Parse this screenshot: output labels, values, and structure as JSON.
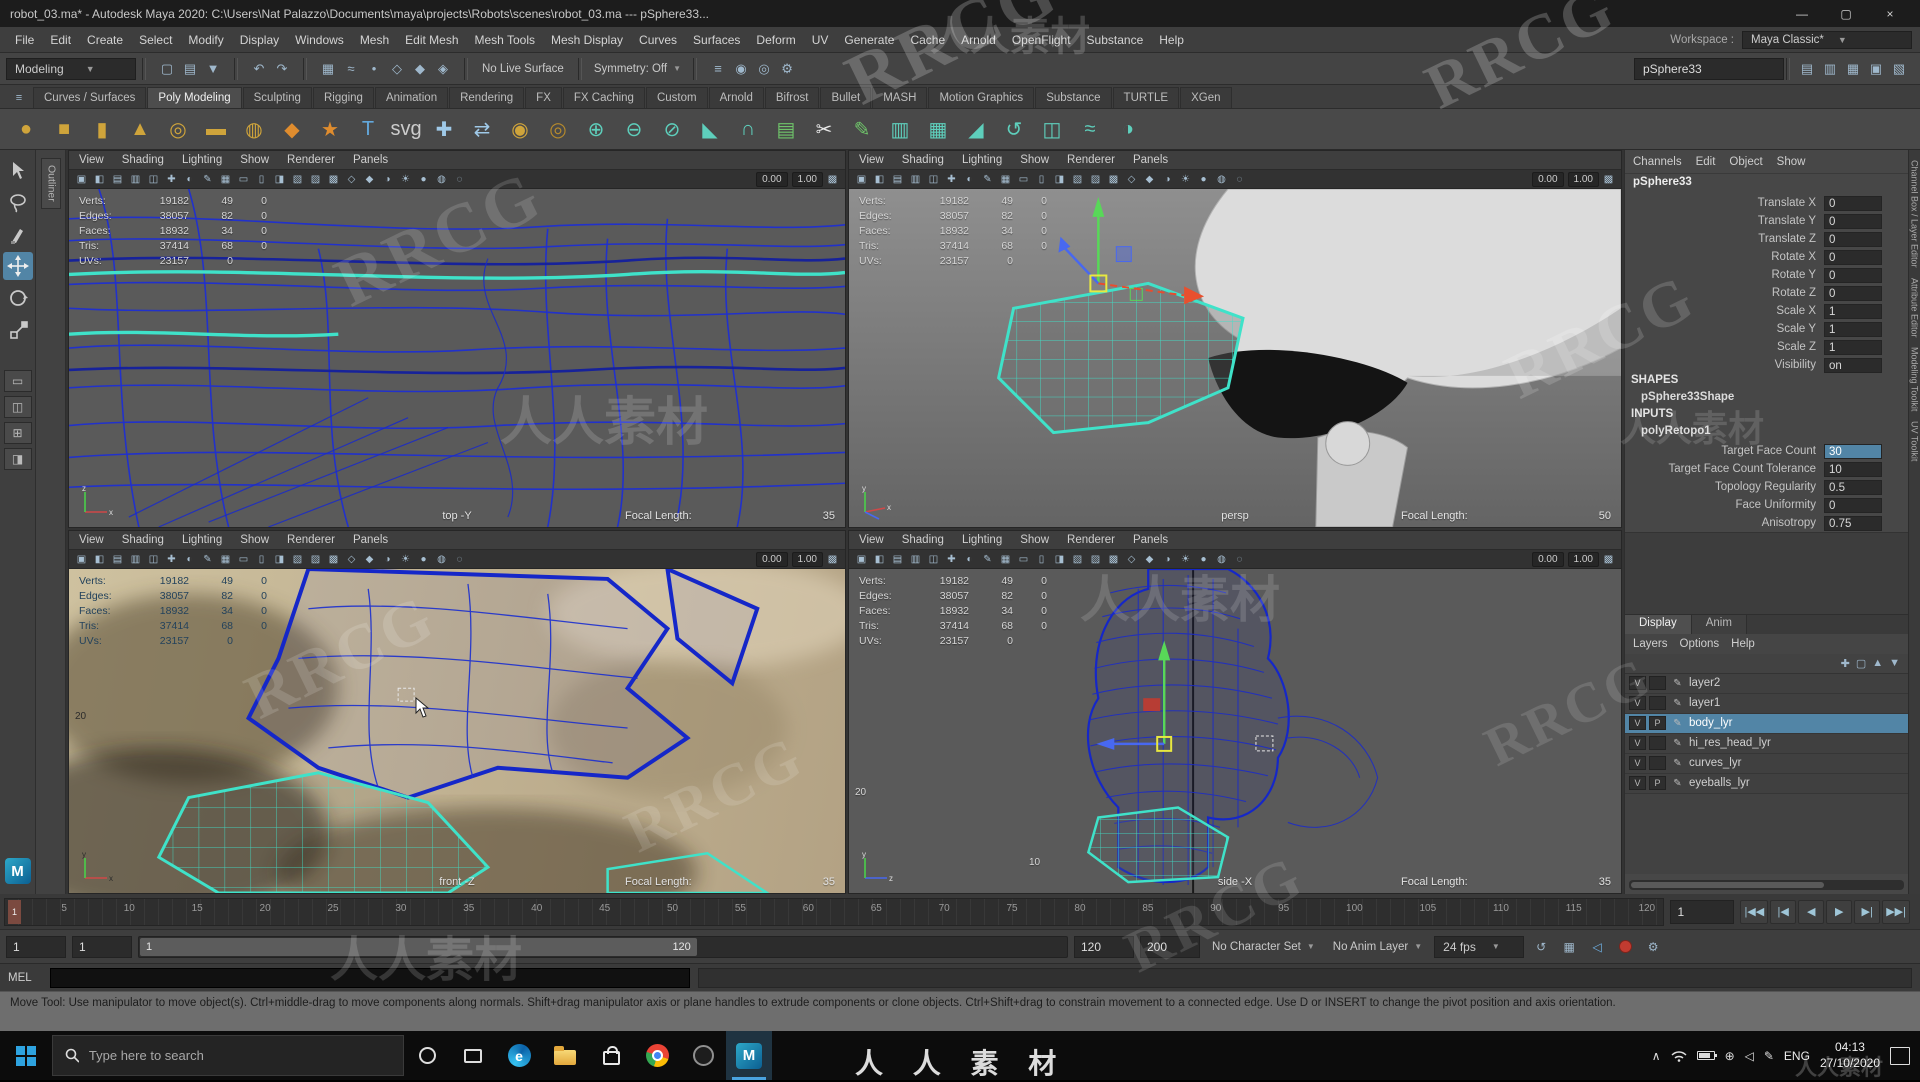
{
  "watermark": {
    "cn": "人人素材",
    "en": "RRCG",
    "taskbar_cn": "人 人 素 材"
  },
  "title_bar": {
    "title": "robot_03.ma* - Autodesk Maya 2020: C:\\Users\\Nat Palazzo\\Documents\\maya\\projects\\Robots\\scenes\\robot_03.ma  ---  pSphere33...",
    "minimize": "—",
    "maximize": "▢",
    "close": "×"
  },
  "menu_bar": {
    "items": [
      "File",
      "Edit",
      "Create",
      "Select",
      "Modify",
      "Display",
      "Windows",
      "Mesh",
      "Edit Mesh",
      "Mesh Tools",
      "Mesh Display",
      "Curves",
      "Surfaces",
      "Deform",
      "UV",
      "Generate",
      "Cache",
      "Arnold",
      "OpenFlight",
      "Substance",
      "Help"
    ],
    "workspace_label": "Workspace :",
    "workspace_value": "Maya Classic*",
    "workspace_caret": "▼"
  },
  "status_line": {
    "mode": "Modeling",
    "mode_caret": "▼",
    "file_icons": [
      {
        "name": "new-scene-icon",
        "glyph": "▢"
      },
      {
        "name": "open-scene-icon",
        "glyph": "▤"
      },
      {
        "name": "save-scene-icon",
        "glyph": "▼"
      }
    ],
    "undo_icons": [
      {
        "name": "undo-icon",
        "glyph": "↶"
      },
      {
        "name": "redo-icon",
        "glyph": "↷"
      }
    ],
    "snap_icons": [
      {
        "name": "snap-grid-icon",
        "glyph": "▦"
      },
      {
        "name": "snap-curve-icon",
        "glyph": "≈"
      },
      {
        "name": "snap-point-icon",
        "glyph": "•"
      },
      {
        "name": "snap-plane-icon",
        "glyph": "◇"
      },
      {
        "name": "snap-surface-icon",
        "glyph": "◆"
      },
      {
        "name": "make-live-icon",
        "glyph": "◈"
      }
    ],
    "history_icons": [
      {
        "name": "construction-history-icon",
        "glyph": "≡"
      },
      {
        "name": "render-icon",
        "glyph": "◉"
      },
      {
        "name": "ipr-render-icon",
        "glyph": "◎"
      },
      {
        "name": "render-settings-icon",
        "glyph": "⚙"
      }
    ],
    "live_surface": "No Live Surface",
    "symmetry": "Symmetry: Off",
    "symmetry_caret": "▼",
    "selection_field": "pSphere33",
    "sidebar_icons": [
      {
        "name": "attribute-editor-toggle-icon",
        "glyph": "▤"
      },
      {
        "name": "tool-settings-toggle-icon",
        "glyph": "▥"
      },
      {
        "name": "channel-box-toggle-icon",
        "glyph": "▦"
      },
      {
        "name": "modeling-toolkit-toggle-icon",
        "glyph": "▣"
      },
      {
        "name": "outliner-toggle-icon",
        "glyph": "▧"
      }
    ]
  },
  "shelf": {
    "menu_glyph": "≡",
    "tabs": [
      {
        "label": "Curves / Surfaces"
      },
      {
        "label": "Poly Modeling",
        "active": true
      },
      {
        "label": "Sculpting"
      },
      {
        "label": "Rigging"
      },
      {
        "label": "Animation"
      },
      {
        "label": "Rendering"
      },
      {
        "label": "FX"
      },
      {
        "label": "FX Caching"
      },
      {
        "label": "Custom"
      },
      {
        "label": "Arnold"
      },
      {
        "label": "Bifrost"
      },
      {
        "label": "Bullet"
      },
      {
        "label": "MASH"
      },
      {
        "label": "Motion Graphics"
      },
      {
        "label": "Substance"
      },
      {
        "label": "TURTLE"
      },
      {
        "label": "XGen"
      }
    ],
    "icons": [
      {
        "name": "poly-sphere-icon",
        "glyph": "●",
        "color": "#cfa43b"
      },
      {
        "name": "poly-cube-icon",
        "glyph": "■",
        "color": "#cfa43b"
      },
      {
        "name": "poly-cylinder-icon",
        "glyph": "▮",
        "color": "#cfa43b"
      },
      {
        "name": "poly-cone-icon",
        "glyph": "▲",
        "color": "#cfa43b"
      },
      {
        "name": "poly-torus-icon",
        "glyph": "◎",
        "color": "#cfa43b"
      },
      {
        "name": "poly-plane-icon",
        "glyph": "▬",
        "color": "#cfa43b"
      },
      {
        "name": "poly-disc-icon",
        "glyph": "◍",
        "color": "#cfa43b"
      },
      {
        "name": "platonic-solid-icon",
        "glyph": "◆",
        "color": "#df8c2e"
      },
      {
        "name": "super-shape-icon",
        "glyph": "★",
        "color": "#df8c2e"
      },
      {
        "name": "poly-text-icon",
        "glyph": "T",
        "color": "#63a8dc"
      },
      {
        "name": "svg-tool-icon",
        "glyph": "svg",
        "color": "#cccccc"
      },
      {
        "name": "show-manipulator-icon",
        "glyph": "✚",
        "color": "#9fc9e8"
      },
      {
        "name": "align-icon",
        "glyph": "⇄",
        "color": "#9fc9e8"
      },
      {
        "name": "boolean-union-icon",
        "glyph": "◉",
        "color": "#cfa43b"
      },
      {
        "name": "boolean-difference-icon",
        "glyph": "◎",
        "color": "#b68a2c"
      },
      {
        "name": "combine-icon",
        "glyph": "⊕",
        "color": "#5ecfbc"
      },
      {
        "name": "separate-icon",
        "glyph": "⊖",
        "color": "#5ecfbc"
      },
      {
        "name": "extract-icon",
        "glyph": "⊘",
        "color": "#5ecfbc"
      },
      {
        "name": "bevel-icon",
        "glyph": "◣",
        "color": "#5ecfbc"
      },
      {
        "name": "bridge-icon",
        "glyph": "∩",
        "color": "#5ecfbc"
      },
      {
        "name": "extrude-icon",
        "glyph": "▤",
        "color": "#6fc46a"
      },
      {
        "name": "multi-cut-icon",
        "glyph": "✂",
        "color": "#e8e8e8"
      },
      {
        "name": "quad-draw-icon",
        "glyph": "✎",
        "color": "#6fc46a"
      },
      {
        "name": "insert-edge-loop-icon",
        "glyph": "▥",
        "color": "#5ecfbc"
      },
      {
        "name": "offset-edge-loop-icon",
        "glyph": "▦",
        "color": "#5ecfbc"
      },
      {
        "name": "crease-tool-icon",
        "glyph": "◢",
        "color": "#5ecfbc"
      },
      {
        "name": "spin-edge-icon",
        "glyph": "↺",
        "color": "#5ecfbc"
      },
      {
        "name": "symmetrize-icon",
        "glyph": "◫",
        "color": "#5ecfbc"
      },
      {
        "name": "average-vertices-icon",
        "glyph": "≈",
        "color": "#5ecfbc"
      },
      {
        "name": "smooth-icon",
        "glyph": "◑",
        "color": "#5ecfbc"
      }
    ]
  },
  "left_strip": {
    "outliner_label": "Outliner"
  },
  "viewport_menus": [
    "View",
    "Shading",
    "Lighting",
    "Show",
    "Renderer",
    "Panels"
  ],
  "viewport_toolbar": {
    "icons": [
      {
        "name": "select-camera-icon",
        "glyph": "▣"
      },
      {
        "name": "lock-camera-icon",
        "glyph": "◧"
      },
      {
        "name": "camera-attributes-icon",
        "glyph": "▤"
      },
      {
        "name": "bookmarks-icon",
        "glyph": "▥"
      },
      {
        "name": "image-plane-icon",
        "glyph": "◫"
      },
      {
        "name": "pan-zoom-icon",
        "glyph": "✚"
      },
      {
        "name": "oversampling-icon",
        "glyph": "◐"
      },
      {
        "name": "grease-pencil-icon",
        "glyph": "✎"
      },
      {
        "name": "grid-icon",
        "glyph": "▦"
      },
      {
        "name": "film-gate-icon",
        "glyph": "▭"
      },
      {
        "name": "resolution-gate-icon",
        "glyph": "▯"
      },
      {
        "name": "gate-mask-icon",
        "glyph": "◨"
      },
      {
        "name": "field-chart-icon",
        "glyph": "▧"
      },
      {
        "name": "safe-action-icon",
        "glyph": "▨"
      },
      {
        "name": "safe-title-icon",
        "glyph": "▩"
      },
      {
        "name": "wireframe-mode-icon",
        "glyph": "◇"
      },
      {
        "name": "shaded-mode-icon",
        "glyph": "◆"
      },
      {
        "name": "textured-mode-icon",
        "glyph": "◑"
      },
      {
        "name": "use-all-lights-icon",
        "glyph": "☀"
      },
      {
        "name": "shadows-icon",
        "glyph": "●"
      },
      {
        "name": "ambient-occlusion-icon",
        "glyph": "◍"
      },
      {
        "name": "motion-blur-icon",
        "glyph": "◌"
      }
    ],
    "exposure": "0.00",
    "gamma": "1.00",
    "isolate_glyph": "▩"
  },
  "viewport_hud": {
    "rows": [
      {
        "label": "Verts:",
        "c1": "19182",
        "c2": "49",
        "c3": "0"
      },
      {
        "label": "Edges:",
        "c1": "38057",
        "c2": "82",
        "c3": "0"
      },
      {
        "label": "Faces:",
        "c1": "18932",
        "c2": "34",
        "c3": "0"
      },
      {
        "label": "Tris:",
        "c1": "37414",
        "c2": "68",
        "c3": "0"
      },
      {
        "label": "UVs:",
        "c1": "23157",
        "c2": "0",
        "c3": ""
      }
    ]
  },
  "labels": {
    "focal_length": "Focal Length:"
  },
  "viewports": [
    {
      "camera": "top -Y",
      "focal": "35"
    },
    {
      "camera": "persp",
      "focal": "50"
    },
    {
      "camera": "front -Z",
      "focal": "35",
      "grid": "20"
    },
    {
      "camera": "side -X",
      "focal": "35",
      "grid": "20",
      "grid2": "10"
    }
  ],
  "channel_box": {
    "menus": [
      "Channels",
      "Edit",
      "Object",
      "Show"
    ],
    "object_name": "pSphere33",
    "transform_attrs": [
      {
        "label": "Translate X",
        "value": "0"
      },
      {
        "label": "Translate Y",
        "value": "0"
      },
      {
        "label": "Translate Z",
        "value": "0"
      },
      {
        "label": "Rotate X",
        "value": "0"
      },
      {
        "label": "Rotate Y",
        "value": "0"
      },
      {
        "label": "Rotate Z",
        "value": "0"
      },
      {
        "label": "Scale X",
        "value": "1"
      },
      {
        "label": "Scale Y",
        "value": "1"
      },
      {
        "label": "Scale Z",
        "value": "1"
      },
      {
        "label": "Visibility",
        "value": "on"
      }
    ],
    "shapes_header": "SHAPES",
    "shape_name": "pSphere33Shape",
    "inputs_header": "INPUTS",
    "input_name": "polyRetopo1",
    "input_attrs": [
      {
        "label": "Target Face Count",
        "value": "30",
        "hl": true
      },
      {
        "label": "Target Face Count Tolerance",
        "value": "10"
      },
      {
        "label": "Topology Regularity",
        "value": "0.5"
      },
      {
        "label": "Face Uniformity",
        "value": "0"
      },
      {
        "label": "Anisotropy",
        "value": "0.75"
      }
    ]
  },
  "layer_editor": {
    "tabs": [
      {
        "label": "Display",
        "active": true
      },
      {
        "label": "Anim"
      }
    ],
    "menus": [
      "Layers",
      "Options",
      "Help"
    ],
    "icons": [
      {
        "name": "add-layer-icon",
        "glyph": "✚"
      },
      {
        "name": "add-empty-layer-icon",
        "glyph": "▢"
      },
      {
        "name": "move-layer-up-icon",
        "glyph": "▲"
      },
      {
        "name": "move-layer-down-icon",
        "glyph": "▼"
      }
    ],
    "layers": [
      {
        "v": "V",
        "p": "",
        "name": "layer2"
      },
      {
        "v": "V",
        "p": "",
        "name": "layer1"
      },
      {
        "v": "V",
        "p": "P",
        "name": "body_lyr",
        "selected": true
      },
      {
        "v": "V",
        "p": "",
        "name": "hi_res_head_lyr"
      },
      {
        "v": "V",
        "p": "",
        "name": "curves_lyr"
      },
      {
        "v": "V",
        "p": "P",
        "name": "eyeballs_lyr"
      }
    ]
  },
  "right_strip": {
    "labels": [
      "Channel Box / Layer Editor",
      "Attribute Editor",
      "Modeling Toolkit",
      "UV Toolkit"
    ]
  },
  "timeline": {
    "ticks": [
      "5",
      "10",
      "15",
      "20",
      "25",
      "30",
      "35",
      "40",
      "45",
      "50",
      "55",
      "60",
      "65",
      "70",
      "75",
      "80",
      "85",
      "90",
      "95",
      "100",
      "105",
      "110",
      "115",
      "120"
    ],
    "current_frame": "1",
    "frame_field": "1",
    "transport": [
      {
        "name": "go-to-start-button",
        "glyph": "|◀◀"
      },
      {
        "name": "step-back-key-button",
        "glyph": "|◀"
      },
      {
        "name": "step-back-frame-button",
        "glyph": "◀"
      },
      {
        "name": "play-forward-button",
        "glyph": "▶"
      },
      {
        "name": "step-forward-frame-button",
        "glyph": "▶|"
      },
      {
        "name": "go-to-end-button",
        "glyph": "▶▶|"
      }
    ]
  },
  "range_slider": {
    "anim_start": "1",
    "play_start": "1",
    "range_start_label": "1",
    "range_end_label": "120",
    "play_end": "120",
    "anim_end": "200",
    "character_set": "No Character Set",
    "anim_layer": "No Anim Layer",
    "fps": "24 fps",
    "caret": "▼"
  },
  "command_line": {
    "label": "MEL"
  },
  "help_line": {
    "text": "Move Tool: Use manipulator to move object(s). Ctrl+middle-drag to move components along normals. Shift+drag manipulator axis or plane handles to extrude components or clone objects. Ctrl+Shift+drag to constrain movement to a connected edge. Use D or INSERT to change the pivot position and axis orientation."
  },
  "taskbar": {
    "search_placeholder": "Type here to search",
    "language": "ENG",
    "time": "04:13",
    "date": "27/10/2020",
    "chevron": "∧",
    "globe": "⊕",
    "pen": "✎",
    "speaker": "◁"
  }
}
